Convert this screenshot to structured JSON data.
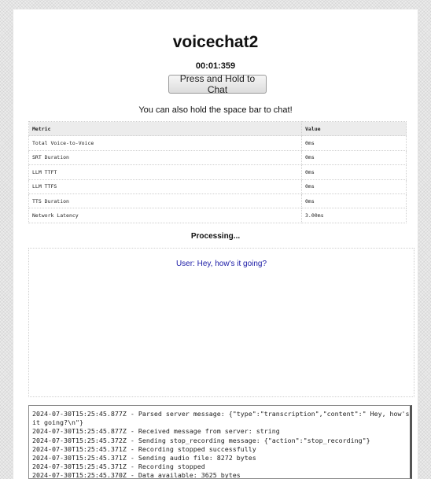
{
  "app": {
    "title": "voicechat2",
    "timer": "00:01:359",
    "hold_button_label": "Press and Hold to Chat",
    "hint": "You can also hold the space bar to chat!"
  },
  "metrics": {
    "headers": [
      "Metric",
      "Value"
    ],
    "rows": [
      [
        "Total Voice-to-Voice",
        "0ms"
      ],
      [
        "SRT Duration",
        "0ms"
      ],
      [
        "LLM TTFT",
        "0ms"
      ],
      [
        "LLM TTFS",
        "0ms"
      ],
      [
        "TTS Duration",
        "0ms"
      ],
      [
        "Network Latency",
        "3.00ms"
      ]
    ]
  },
  "status": "Processing...",
  "chat": {
    "messages": [
      "User: Hey, how's it going?"
    ]
  },
  "log": {
    "lines": [
      "2024-07-30T15:25:45.877Z - Parsed server message: {\"type\":\"transcription\",\"content\":\" Hey, how's it going?\\n\"}",
      "2024-07-30T15:25:45.877Z - Received message from server: string",
      "2024-07-30T15:25:45.372Z - Sending stop_recording message: {\"action\":\"stop_recording\"}",
      "2024-07-30T15:25:45.371Z - Recording stopped successfully",
      "2024-07-30T15:25:45.371Z - Sending audio file: 8272 bytes",
      "2024-07-30T15:25:45.371Z - Recording stopped",
      "2024-07-30T15:25:45.370Z - Data available: 3625 bytes"
    ]
  }
}
